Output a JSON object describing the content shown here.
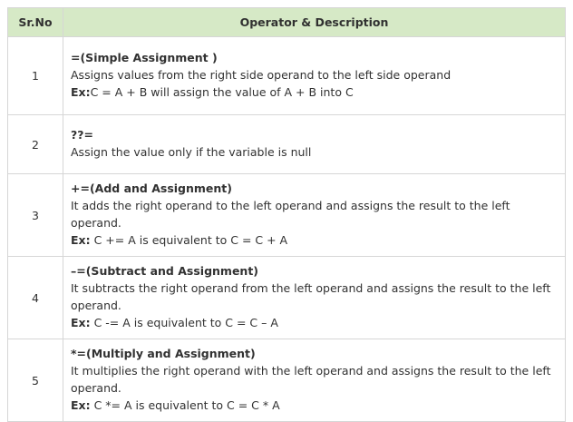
{
  "headers": {
    "sr_no": "Sr.No",
    "description": "Operator & Description"
  },
  "rows": [
    {
      "no": "1",
      "title": "=(Simple Assignment )",
      "desc": "Assigns values from the right side operand to the left side operand",
      "ex_label": "Ex:",
      "example": "C = A + B will assign the value of A + B into C"
    },
    {
      "no": "2",
      "title": "??=",
      "desc": "Assign the value only if the variable is null"
    },
    {
      "no": "3",
      "title": "+=(Add and Assignment)",
      "desc": "It adds the right operand to the left operand and assigns the result to the left operand.",
      "ex_label": "Ex:",
      "example": " C += A is equivalent to C = C + A"
    },
    {
      "no": "4",
      "title": "–=(Subtract and Assignment)",
      "desc": "It subtracts the right operand from the left operand and assigns the result to the left operand.",
      "ex_label": "Ex:",
      "example": " C -= A is equivalent to C = C – A"
    },
    {
      "no": "5",
      "title": "*=(Multiply and Assignment)",
      "desc": "It multiplies the right operand with the left operand and assigns the result to the left operand.",
      "ex_label": "Ex:",
      "example": " C *= A is equivalent to C = C * A"
    }
  ]
}
